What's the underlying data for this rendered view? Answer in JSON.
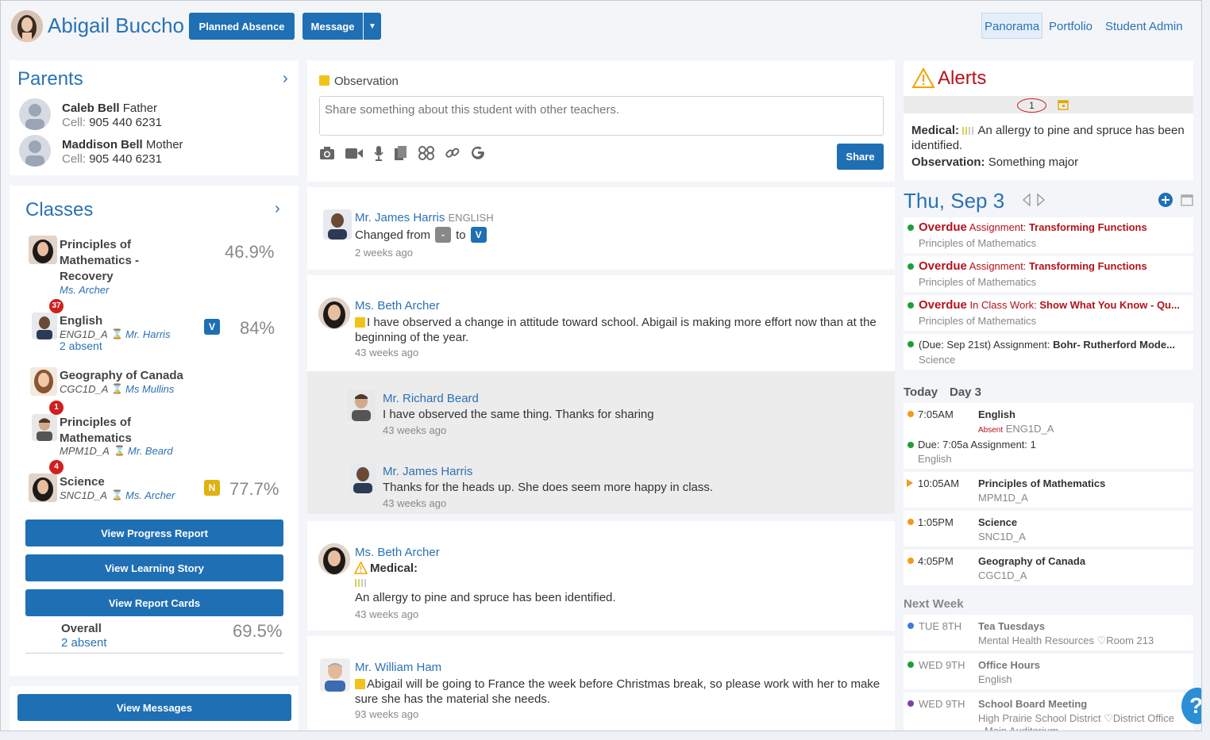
{
  "header": {
    "student_name": "Abigail Buccho",
    "planned_absence": "Planned Absence",
    "message": "Message",
    "nav": [
      "Panorama",
      "Portfolio",
      "Student Admin"
    ]
  },
  "parents": {
    "title": "Parents",
    "items": [
      {
        "name": "Caleb Bell",
        "relation": "Father",
        "cell_label": "Cell:",
        "cell": "905 440 6231"
      },
      {
        "name": "Maddison Bell",
        "relation": "Mother",
        "cell_label": "Cell:",
        "cell": "905 440 6231"
      }
    ]
  },
  "classes": {
    "title": "Classes",
    "items": [
      {
        "name": "Principles of Mathematics - Recovery",
        "code": "",
        "teacher": "Ms. Archer",
        "absent": "",
        "badge": "",
        "tag": "",
        "grade": "46.9%"
      },
      {
        "name": "English",
        "code": "ENG1D_A",
        "teacher": "Mr. Harris",
        "absent": "2 absent",
        "badge": "37",
        "tag": "V",
        "grade": "84%"
      },
      {
        "name": "Geography of Canada",
        "code": "CGC1D_A",
        "teacher": "Ms Mullins",
        "absent": "",
        "badge": "",
        "tag": "",
        "grade": ""
      },
      {
        "name": "Principles of Mathematics",
        "code": "MPM1D_A",
        "teacher": "Mr. Beard",
        "absent": "",
        "badge": "1",
        "tag": "",
        "grade": ""
      },
      {
        "name": "Science",
        "code": "SNC1D_A",
        "teacher": "Ms. Archer",
        "absent": "",
        "badge": "4",
        "tag": "N",
        "grade": "77.7%"
      }
    ],
    "buttons": [
      "View Progress Report",
      "View Learning Story",
      "View Report Cards"
    ],
    "overall_label": "Overall",
    "overall_absent": "2 absent",
    "overall_grade": "69.5%",
    "view_messages": "View Messages"
  },
  "observation": {
    "label": "Observation",
    "placeholder": "Share something about this student with other teachers.",
    "share": "Share"
  },
  "feed": [
    {
      "author": "Mr. James Harris",
      "subject": "ENGLISH",
      "changed_from": "Changed from",
      "from_tag": "-",
      "to": "to",
      "to_tag": "V",
      "time": "2 weeks ago"
    },
    {
      "author": "Ms. Beth Archer",
      "text": "I have observed a change in attitude toward school. Abigail is making more effort now than at the beginning of the year.",
      "time": "43 weeks ago",
      "replies": [
        {
          "author": "Mr. Richard Beard",
          "text": "I have observed the same thing. Thanks for sharing",
          "time": "43 weeks ago"
        },
        {
          "author": "Mr. James Harris",
          "text": "Thanks for the heads up. She does seem more happy in class.",
          "time": "43 weeks ago"
        }
      ]
    },
    {
      "author": "Ms. Beth Archer",
      "heading": "Medical:",
      "text": "An allergy to pine and spruce has been identified.",
      "time": "43 weeks ago"
    },
    {
      "author": "Mr. William Ham",
      "text": "Abigail will be going to France the week before Christmas break, so please work with her to make sure she has the material she needs.",
      "time": "93 weeks ago"
    }
  ],
  "alerts": {
    "title": "Alerts",
    "count": "1",
    "medical_label": "Medical:",
    "medical_text": "An allergy to pine and spruce has been identified.",
    "observation_label": "Observation:",
    "observation_text": "Something major"
  },
  "agenda": {
    "date": "Thu, Sep 3",
    "items": [
      {
        "status": "Overdue",
        "type": "Assignment:",
        "title": "Transforming Functions",
        "course": "Principles of Mathematics"
      },
      {
        "status": "Overdue",
        "type": "Assignment:",
        "title": "Transforming Functions",
        "course": "Principles of Mathematics"
      },
      {
        "status": "Overdue",
        "type": "In Class Work:",
        "title": "Show What You Know - Qu...",
        "course": "Principles of Mathematics"
      },
      {
        "status": "(Due: Sep 21st)",
        "type": "Assignment:",
        "title": "Bohr- Rutherford Mode...",
        "course": "Science"
      }
    ],
    "today_label": "Today",
    "day_label": "Day 3",
    "schedule": [
      {
        "time": "7:05AM",
        "course": "English",
        "note_label": "Absent",
        "code": "ENG1D_A",
        "due": "Due: 7:05a Assignment: 1",
        "due_course": "English"
      },
      {
        "time": "10:05AM",
        "course": "Principles of Mathematics",
        "code": "MPM1D_A"
      },
      {
        "time": "1:05PM",
        "course": "Science",
        "code": "SNC1D_A"
      },
      {
        "time": "4:05PM",
        "course": "Geography of Canada",
        "code": "CGC1D_A"
      }
    ],
    "next_week_label": "Next Week",
    "next_week": [
      {
        "day": "TUE 8TH",
        "title": "Tea Tuesdays",
        "sub": "Mental Health Resources",
        "loc": "Room 213"
      },
      {
        "day": "WED 9TH",
        "title": "Office Hours",
        "sub": "English",
        "loc": ""
      },
      {
        "day": "WED 9TH",
        "title": "School Board Meeting",
        "sub": "High Prairie School District",
        "loc": "District Office - Main Auditorium"
      }
    ]
  },
  "colors": {
    "primary": "#1f6fb4",
    "overdue": "#b5121b",
    "green": "#1e9e3a",
    "orange": "#f29a1a",
    "blue_dot": "#3b7dd8",
    "purple": "#7d3cb5"
  }
}
